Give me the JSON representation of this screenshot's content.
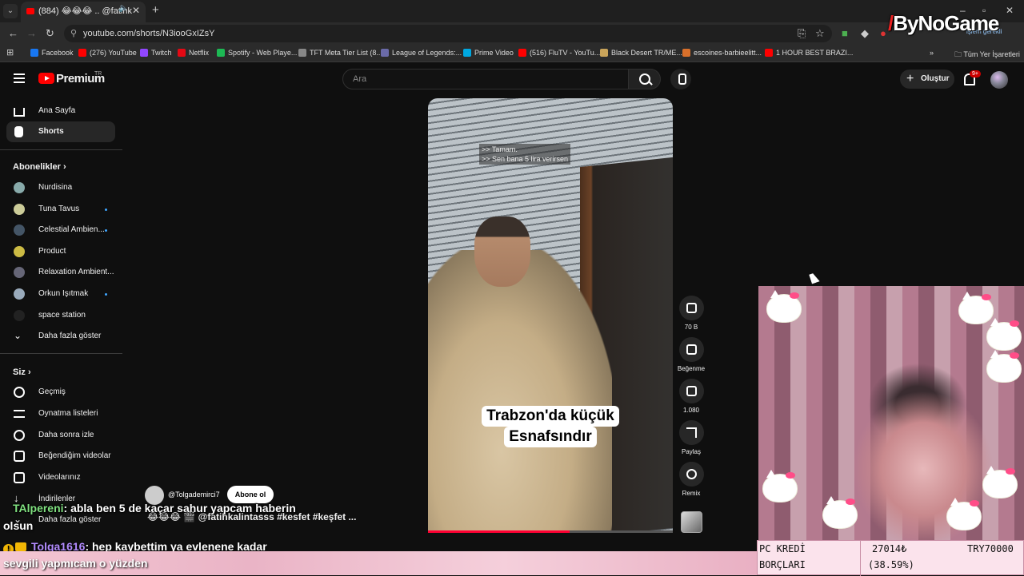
{
  "browser": {
    "tab_title": "(884) 😂😂😂 .. @fatihk",
    "url": "youtube.com/shorts/N3iooGxIZsY",
    "bookmarks": [
      {
        "label": "Facebook",
        "color": "#1877f2"
      },
      {
        "label": "(276) YouTube",
        "color": "#ff0000"
      },
      {
        "label": "Twitch",
        "color": "#9146ff"
      },
      {
        "label": "Netflix",
        "color": "#e50914"
      },
      {
        "label": "Spotify - Web Playe...",
        "color": "#1db954"
      },
      {
        "label": "TFT Meta Tier List (8...",
        "color": "#888888"
      },
      {
        "label": "League of Legends:...",
        "color": "#6a6aa8"
      },
      {
        "label": "Prime Video",
        "color": "#00a8e1"
      },
      {
        "label": "(516) FluTV - YouTu...",
        "color": "#ff0000"
      },
      {
        "label": "Black Desert TR/ME...",
        "color": "#c9a45a"
      },
      {
        "label": "escoines-barbieelitt...",
        "color": "#d9702b"
      },
      {
        "label": "1 HOUR BEST BRAZI...",
        "color": "#ff0000"
      }
    ],
    "all_bookmarks": "Tüm Yer İşaretleri",
    "profile_chip": "işlem gerekli"
  },
  "watermark": "ByNoGame",
  "youtube": {
    "logo_text": "Premium",
    "logo_region": "TR",
    "search_placeholder": "Ara",
    "create_label": "Oluştur",
    "notif_count": "9+",
    "sidebar": {
      "main": [
        {
          "label": "Ana Sayfa",
          "icon": "home-icon"
        },
        {
          "label": "Shorts",
          "icon": "shorts-icon",
          "active": true
        }
      ],
      "subs_header": "Abonelikler",
      "subscriptions": [
        {
          "label": "Nurdisina",
          "color": "#8aa",
          "dot": false
        },
        {
          "label": "Tuna Tavus",
          "color": "#cc9",
          "dot": true
        },
        {
          "label": "Celestial Ambien...",
          "color": "#456",
          "dot": true
        },
        {
          "label": "Product",
          "color": "#cb4",
          "dot": false
        },
        {
          "label": "Relaxation Ambient...",
          "color": "#667",
          "dot": false
        },
        {
          "label": "Orkun Işıtmak",
          "color": "#9ab",
          "dot": true
        },
        {
          "label": "space station",
          "color": "#222",
          "dot": false
        }
      ],
      "show_more": "Daha fazla göster",
      "you_header": "Siz",
      "you_items": [
        {
          "label": "Geçmiş",
          "icon": "history-icon"
        },
        {
          "label": "Oynatma listeleri",
          "icon": "playlists-icon"
        },
        {
          "label": "Daha sonra izle",
          "icon": "watch-later-icon"
        },
        {
          "label": "Beğendiğim videolar",
          "icon": "liked-icon"
        },
        {
          "label": "Videolarınız",
          "icon": "your-videos-icon"
        },
        {
          "label": "İndirilenler",
          "icon": "downloads-icon"
        }
      ],
      "show_more_2": "Daha fazla göster"
    },
    "short": {
      "subtitle": ">> Tamam.\n>> Sen bana 5 lira verirsen",
      "caption_line1": "Trabzon'da küçük",
      "caption_line2": "Esnafsındır",
      "channel": "@Tolgademirci7",
      "subscribe": "Abone ol",
      "description": "😂😂😂 🎬 @fatihkalintasss #kesfet #keşfet ...",
      "progress": 0.58
    },
    "actions": {
      "like_count": "70 B",
      "dislike_label": "Beğenme",
      "comment_count": "1.080",
      "share_label": "Paylaş",
      "remix_label": "Remix"
    }
  },
  "stream_overlay": {
    "chat1_user": "TAlpereni",
    "chat1_text": ": abla ben 5 de kaçar sahur yapcam haberin",
    "chat1_cont": "olsun",
    "chat2_user": "Tolga1616",
    "chat2_text": ": hep kaybettim ya evlenene kadar",
    "chat2_cont": "sevgili yapmıcam o yüzden",
    "donation": {
      "label1": "PC KREDİ",
      "label2": "BORÇLARI",
      "amount": "27014₺",
      "percent": "(38.59%)",
      "target": "TRY70000"
    }
  }
}
